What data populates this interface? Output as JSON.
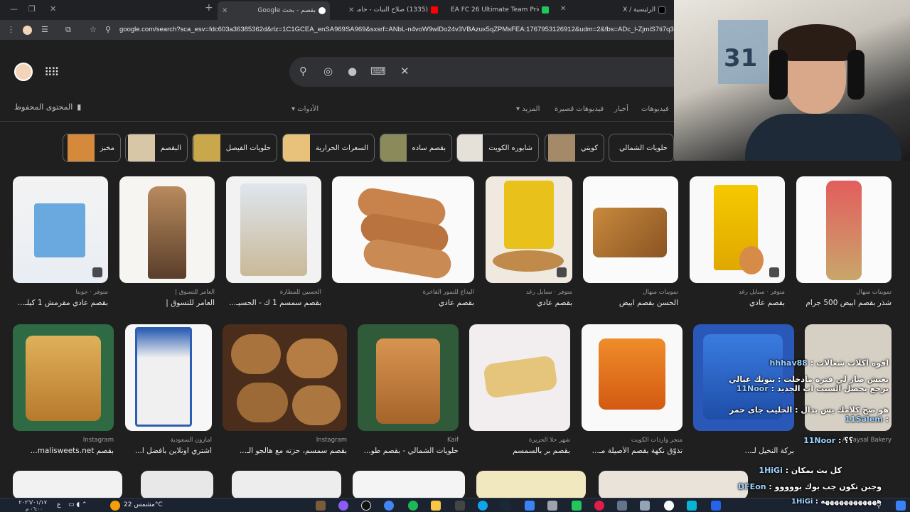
{
  "browser": {
    "tabs": [
      {
        "title": "بقصم - بحث Google",
        "active": true
      },
      {
        "title": "(1335) صلاح النبات - حامد الـ"
      },
      {
        "title": "EA FC 26 Ultimate Team Prices"
      },
      {
        "title": "الرئيسية / X"
      }
    ],
    "url": "google.com/search?sca_esv=fdc603a36385362d&rlz=1C1GCEA_enSA969SA969&sxsrf=ANbL-n4voW9wlDo24v3VBAzux5qZPMsFEA:1767953126912&udm=2&fbs=ADc_l-ZjmiS7ti7q3ZmZMa"
  },
  "google": {
    "saved_label": "المحتوى المحفوظ",
    "tools_label": "الأدوات",
    "filters": [
      "فيديوهات",
      "أخبار",
      "فيديوهات قصيرة",
      "المزيد"
    ],
    "chips": [
      "حلويات الشمالي",
      "كويتي",
      "شابوره الكويت",
      "بقصم ساده",
      "السعرات الحرارية",
      "حلويات الفيصل",
      "البقصم",
      "مخبز"
    ],
    "row1": [
      {
        "source": "متوفر · جوبتا",
        "title": "بقصم عادي مقرمش 1 كيلـ..."
      },
      {
        "source": "العامر للتسوق |",
        "title": "العامر للتسوق |"
      },
      {
        "source": "الحسين للمطارة",
        "title": "بقصم سمسم 1 ك - الحسيـ..."
      },
      {
        "source": "البداع للتمور الفاخرة",
        "title": "بقصم عادي"
      },
      {
        "source": "متوفر · سنابل رغد",
        "title": "بقصم عادي"
      },
      {
        "source": "تموينات منهال",
        "title": "الحسن بقصم ابيض"
      },
      {
        "source": "متوفر · سنابل رغد",
        "title": "بقصم عادي"
      },
      {
        "source": "تموينات منهال",
        "title": "شذر بقصم ابيض 500 جرام"
      }
    ],
    "row2": [
      {
        "source": "Instagram",
        "title": "بقصم malisweets.net..."
      },
      {
        "source": "أمازون السعودية",
        "title": "اشتري اونلاين بأفضل ا..."
      },
      {
        "source": "Instagram",
        "title": "بقصم سمسم، حزته مع هالجو الـ..."
      },
      {
        "source": "Kaif",
        "title": "حلويات الشمالي - بقصم طو..."
      },
      {
        "source": "شهر حلا الجزيرة",
        "title": "بقصم بر بالسمسم"
      },
      {
        "source": "متجر واردات الكويت",
        "title": "تذوّق نكهة بقصم الأصيلة مـ..."
      },
      {
        "source": "Al Faysal Bakery",
        "title": "بركة النخيل لـ..."
      },
      {
        "source": "",
        "title": ""
      }
    ]
  },
  "chat": [
    {
      "name": "hhhav88",
      "msg": "افوه اكلات شغالات"
    },
    {
      "name": "11Noor",
      "msg": "يعيش صار لي فتره مادخلت : بتوتك عيالي برجع بحصل السيت اب الجديد"
    },
    {
      "name": "11Salem",
      "msg": "هو صح كلامك يس بدال : الحليب جاى حمر"
    },
    {
      "name": "11Noor",
      "msg": "؟؟"
    },
    {
      "name": "1HiGi",
      "msg": "كل بث بمكان"
    },
    {
      "name": "DFEon",
      "msg": "وجبن تكون جب بوك بووووو"
    },
    {
      "name": "1HiGi",
      "msg": "ههههههههههههه"
    }
  ],
  "taskbar": {
    "weather": "مشمس 22°C",
    "time": "٠٦:٠٠ م",
    "date": "٢٠٢٦/٠١/١٧",
    "lang": "ع"
  },
  "cam": {
    "jersey_number": "31"
  }
}
